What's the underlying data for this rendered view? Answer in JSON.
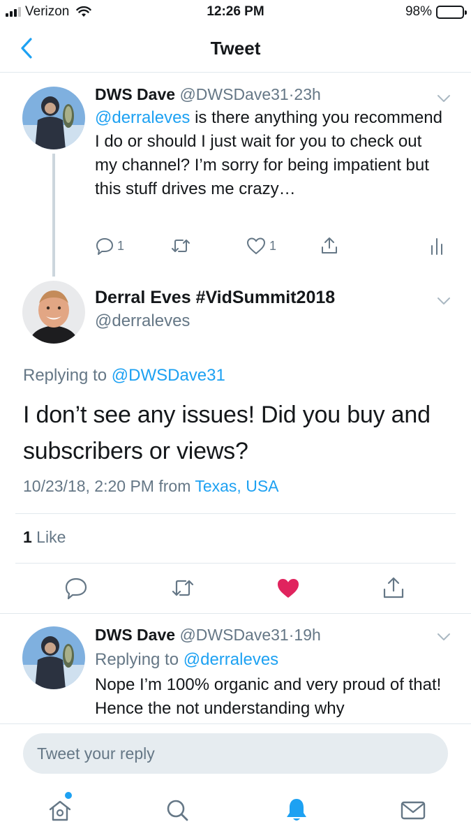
{
  "status_bar": {
    "carrier": "Verizon",
    "time": "12:26 PM",
    "battery": "98%"
  },
  "header": {
    "title": "Tweet"
  },
  "thread_tweet": {
    "name": "DWS Dave",
    "handle": "@DWSDave31",
    "separator": "·",
    "time": "23h",
    "mention": "@derraleves",
    "text": " is there anything you recommend I do or should I just wait for you to check out my channel? I’m sorry for being impatient but this stuff drives me crazy…",
    "reply_count": "1",
    "like_count": "1",
    "icons": [
      "reply-icon",
      "retweet-icon",
      "like-icon",
      "share-icon",
      "analytics-icon"
    ]
  },
  "focused_tweet": {
    "name": "Derral Eves #VidSummit2018",
    "handle": "@derraleves",
    "replying_prefix": "Replying to ",
    "replying_to": "@DWSDave31",
    "text": "I don’t see any issues! Did you buy and subscribers or views?",
    "timestamp": "10/23/18, 2:20 PM",
    "from_prefix": " from ",
    "location": "Texas, USA",
    "likes_count": "1",
    "likes_label": " Like",
    "liked": true,
    "accent_color": "#e0245e"
  },
  "reply_tweet": {
    "name": "DWS Dave",
    "handle": "@DWSDave31",
    "separator": "·",
    "time": "19h",
    "replying_prefix": "Replying to ",
    "replying_to": "@derraleves",
    "text": "Nope I’m 100% organic and very proud of that! Hence the not understanding why"
  },
  "reply_bar": {
    "placeholder": "Tweet your reply"
  },
  "tab_bar": {
    "items": [
      "home-icon",
      "search-icon",
      "notifications-icon",
      "messages-icon"
    ],
    "active": "notifications-icon",
    "accent_color": "#1da1f2"
  }
}
